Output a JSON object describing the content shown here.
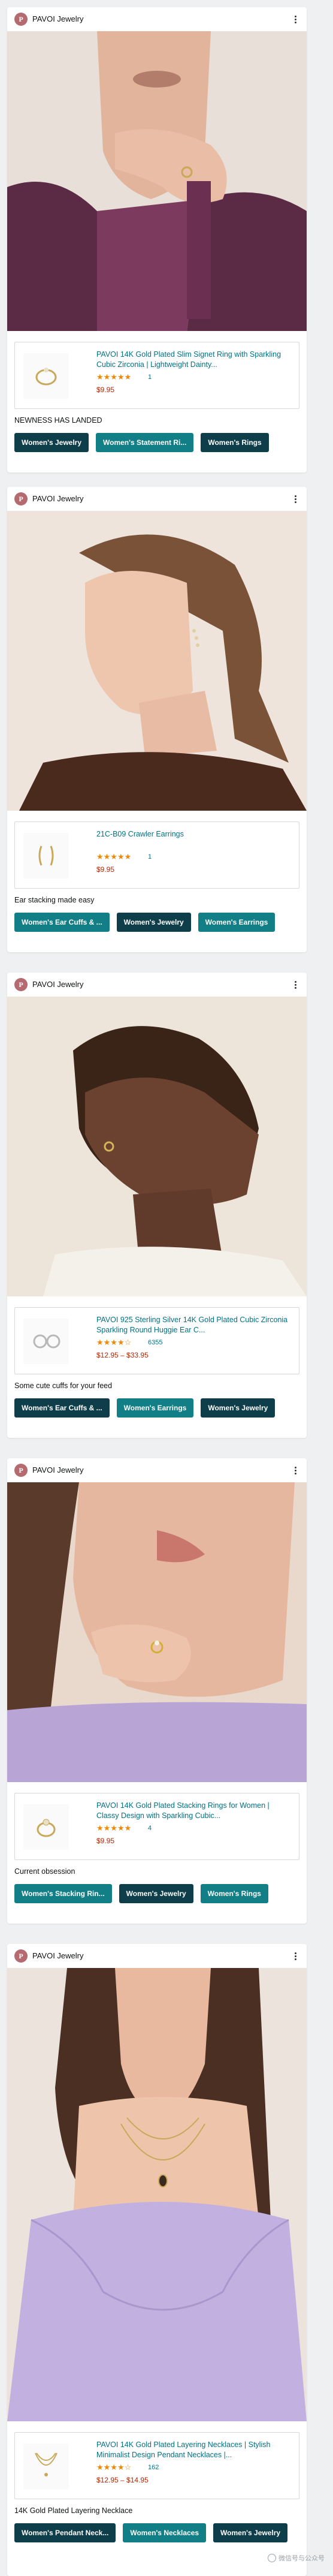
{
  "posts": [
    {
      "brand": "PAVOI Jewelry",
      "avatar_letter": "P",
      "image": "portrait-woman-burgundy-blazer-ring",
      "product": {
        "title": "PAVOI 14K Gold Plated Slim Signet Ring with Sparkling Cubic Zirconia | Lightweight Dainty...",
        "stars": "★★★★★",
        "rating_count": "1",
        "price": "$9.95"
      },
      "caption": "NEWNESS HAS LANDED",
      "chips": [
        {
          "label": "Women's Jewelry",
          "style": "dark"
        },
        {
          "label": "Women's Statement Ri...",
          "style": "teal"
        },
        {
          "label": "Women's Rings",
          "style": "dark"
        }
      ]
    },
    {
      "brand": "PAVOI Jewelry",
      "avatar_letter": "P",
      "image": "portrait-woman-ponytail-ear-crawler",
      "product": {
        "title": "21C-B09 Crawler Earrings",
        "stars": "★★★★★",
        "rating_count": "1",
        "price": "$9.95"
      },
      "caption": "Ear stacking made easy",
      "chips": [
        {
          "label": "Women's Ear Cuffs & ...",
          "style": "teal"
        },
        {
          "label": "Women's Jewelry",
          "style": "dark"
        },
        {
          "label": "Women's Earrings",
          "style": "teal"
        }
      ]
    },
    {
      "brand": "PAVOI Jewelry",
      "avatar_letter": "P",
      "image": "portrait-woman-profile-huggie-earrings",
      "product": {
        "title": "PAVOI 925 Sterling Silver 14K Gold Plated Cubic Zirconia Sparkling Round Huggie Ear C...",
        "stars": "★★★★☆",
        "rating_count": "6355",
        "price": "$12.95 – $33.95"
      },
      "caption": "Some cute cuffs for your feed",
      "chips": [
        {
          "label": "Women's Ear Cuffs & ...",
          "style": "dark"
        },
        {
          "label": "Women's Earrings",
          "style": "teal"
        },
        {
          "label": "Women's Jewelry",
          "style": "dark"
        }
      ]
    },
    {
      "brand": "PAVOI Jewelry",
      "avatar_letter": "P",
      "image": "closeup-hand-stacking-rings",
      "product": {
        "title": "PAVOI 14K Gold Plated Stacking Rings for Women | Classy Design with Sparkling Cubic...",
        "stars": "★★★★★",
        "rating_count": "4",
        "price": "$9.95"
      },
      "caption": "Current obsession",
      "chips": [
        {
          "label": "Women's Stacking Rin...",
          "style": "teal"
        },
        {
          "label": "Women's Jewelry",
          "style": "dark"
        },
        {
          "label": "Women's Rings",
          "style": "teal"
        }
      ]
    },
    {
      "brand": "PAVOI Jewelry",
      "avatar_letter": "P",
      "image": "woman-lavender-top-layered-necklaces",
      "product": {
        "title": "PAVOI 14K Gold Plated Layering Necklaces | Stylish Minimalist Design Pendant Necklaces |...",
        "stars": "★★★★☆",
        "rating_count": "162",
        "price": "$12.95 – $14.95"
      },
      "caption": "14K Gold Plated Layering Necklace",
      "chips": [
        {
          "label": "Women's Pendant Neck...",
          "style": "dark"
        },
        {
          "label": "Women's Necklaces",
          "style": "teal"
        },
        {
          "label": "Women's Jewelry",
          "style": "dark"
        }
      ]
    }
  ],
  "watermark": "微信号与公众号",
  "colors": {
    "link": "#007185",
    "price": "#b12704",
    "star": "#f08804",
    "chip_dark": "#0f3e4b",
    "chip_teal": "#127f86"
  }
}
